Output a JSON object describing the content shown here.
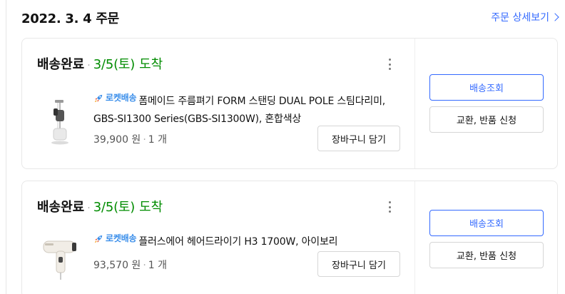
{
  "order": {
    "date": "2022. 3. 4 주문",
    "detail_link": "주문 상세보기"
  },
  "colors": {
    "accent_blue": "#346aff",
    "arrival_green": "#008c00",
    "rocket_blue": "#3a8eea"
  },
  "items": [
    {
      "status": "배송완료",
      "dot": "·",
      "arrival_date": "3/5(토)",
      "arrival_label": "도착",
      "badge": "로켓배송",
      "title": "폼메이드 주름펴기 FORM 스탠딩 DUAL POLE 스팀다리미, GBS-SI1300 Series(GBS-SI1300W), 혼합색상",
      "price": "39,900 원",
      "sep": "·",
      "quantity": "1 개",
      "cart_button": "장바구니 담기",
      "track_button": "배송조회",
      "return_button": "교환, 반품 신청",
      "thumb_icon": "garment-steamer-icon"
    },
    {
      "status": "배송완료",
      "dot": "·",
      "arrival_date": "3/5(토)",
      "arrival_label": "도착",
      "badge": "로켓배송",
      "title": "플러스에어 헤어드라이기 H3 1700W, 아이보리",
      "price": "93,570 원",
      "sep": "·",
      "quantity": "1 개",
      "cart_button": "장바구니 담기",
      "track_button": "배송조회",
      "return_button": "교환, 반품 신청",
      "thumb_icon": "hair-dryer-icon"
    }
  ]
}
